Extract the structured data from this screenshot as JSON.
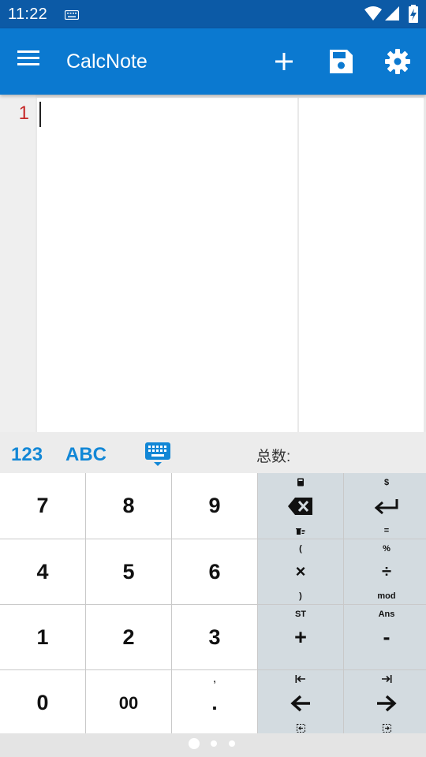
{
  "status_bar": {
    "time": "11:22",
    "icons": [
      "keyboard-icon",
      "wifi-icon",
      "signal-icon",
      "battery-charging-icon"
    ]
  },
  "app_bar": {
    "title": "CalcNote",
    "actions": [
      "menu-icon",
      "add-icon",
      "save-icon",
      "settings-icon"
    ]
  },
  "editor": {
    "line_numbers": [
      "1"
    ],
    "content": "",
    "result": ""
  },
  "keyboard_toolbar": {
    "mode_numeric": "123",
    "mode_alpha": "ABC",
    "total_label": "总数:"
  },
  "keypad": {
    "digits": {
      "seven": "7",
      "eight": "8",
      "nine": "9",
      "four": "4",
      "five": "5",
      "six": "6",
      "one": "1",
      "two": "2",
      "three": "3",
      "zero": "0",
      "double_zero": "00",
      "decimal": ".",
      "decimal_alt": ","
    },
    "ops": {
      "backspace_top": "calculator-icon",
      "backspace_bottom": "clear-all-icon",
      "enter_top": "$",
      "enter_bottom": "=",
      "multiply": "×",
      "multiply_top": "(",
      "multiply_bottom": ")",
      "divide": "÷",
      "divide_top": "%",
      "divide_bottom": "mod",
      "plus": "+",
      "plus_top": "ST",
      "minus": "-",
      "minus_top": "Ans",
      "left_top": "home-icon",
      "left_bottom": "select-left-icon",
      "right_top": "end-icon",
      "right_bottom": "select-right-icon"
    }
  },
  "pager": {
    "pages": 3,
    "current": 1
  },
  "colors": {
    "status_bar": "#0c5aa6",
    "app_bar": "#0b79d0",
    "accent": "#1287d6",
    "line_number": "#c62828",
    "op_key": "#d3dbe0"
  }
}
